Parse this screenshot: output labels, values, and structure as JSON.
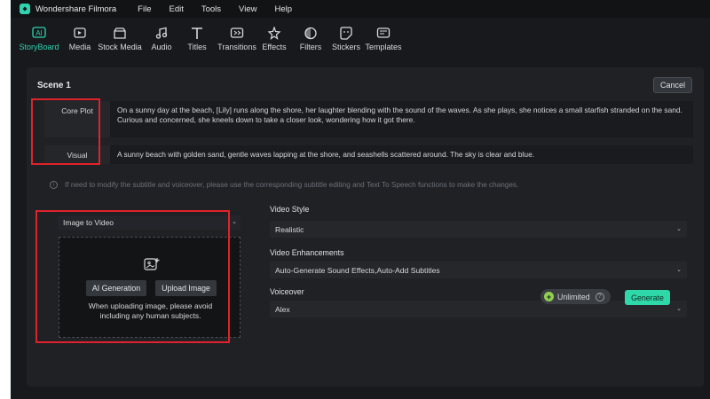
{
  "app": {
    "title": "Wondershare Filmora"
  },
  "menu": [
    "File",
    "Edit",
    "Tools",
    "View",
    "Help"
  ],
  "toolbar": [
    {
      "label": "StoryBoard",
      "icon": "storyboard-icon",
      "active": true
    },
    {
      "label": "Media",
      "icon": "media-icon"
    },
    {
      "label": "Stock Media",
      "icon": "stock-media-icon"
    },
    {
      "label": "Audio",
      "icon": "audio-icon"
    },
    {
      "label": "Titles",
      "icon": "titles-icon"
    },
    {
      "label": "Transitions",
      "icon": "transitions-icon"
    },
    {
      "label": "Effects",
      "icon": "effects-icon"
    },
    {
      "label": "Filters",
      "icon": "filters-icon"
    },
    {
      "label": "Stickers",
      "icon": "stickers-icon"
    },
    {
      "label": "Templates",
      "icon": "templates-icon"
    }
  ],
  "scene": {
    "title": "Scene 1",
    "cancel_label": "Cancel",
    "core_plot_label": "Core Plot",
    "core_plot_text": "On a sunny day at the beach, [Lily] runs along the shore, her laughter blending with the sound of the waves. As she plays, she notices a small starfish stranded on the sand. Curious and concerned, she kneels down to take a closer look, wondering how it got there.",
    "visual_label": "Visual",
    "visual_text": "A sunny beach with golden sand, gentle waves lapping at the shore, and seashells scattered around. The sky is clear and blue.",
    "notice": "If need to modify the subtitle and voiceover, please use the corresponding subtitle editing and Text To Speech functions to make the changes."
  },
  "generator": {
    "mode": "Image to Video",
    "ai_generation_label": "AI Generation",
    "upload_image_label": "Upload Image",
    "upload_hint_1": "When uploading image, please avoid",
    "upload_hint_2": "including any human subjects."
  },
  "settings": {
    "video_style_label": "Video Style",
    "video_style_value": "Realistic",
    "enhancements_label": "Video Enhancements",
    "enhancements_value": "Auto-Generate Sound Effects,Auto-Add Subtitles",
    "voiceover_label": "Voiceover",
    "voiceover_value": "Alex"
  },
  "footer": {
    "unlimited_label": "Unlimited",
    "generate_label": "Generate"
  },
  "colors": {
    "accent": "#2fd3b0",
    "generate_button": "#2fd8a8",
    "highlight_box": "#e0222b"
  }
}
